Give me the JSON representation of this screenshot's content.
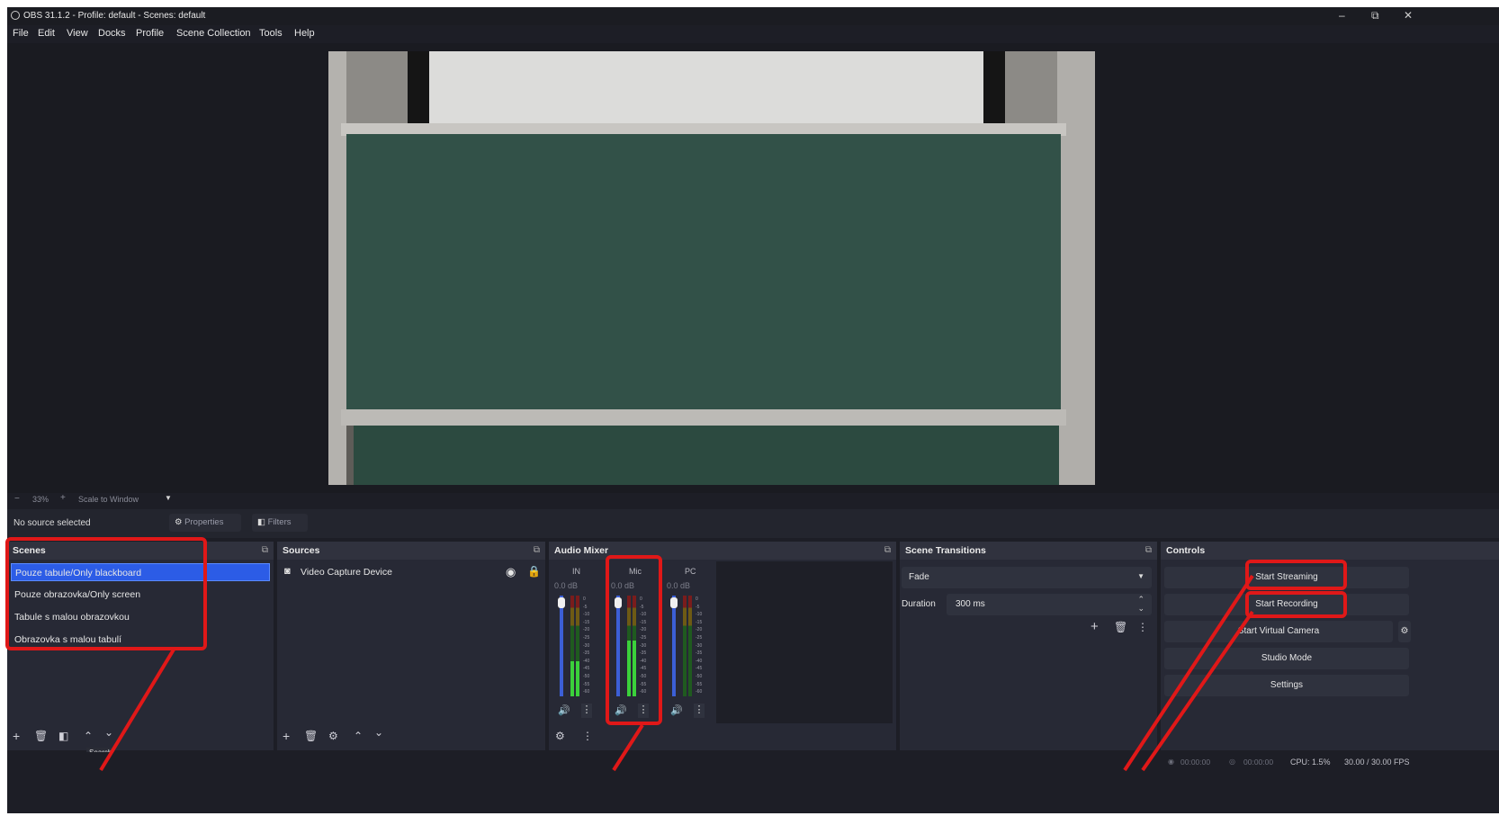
{
  "window": {
    "title": "OBS 31.1.2 - Profile: default - Scenes: default",
    "minimize": "–",
    "restore": "⧉",
    "close": "✕"
  },
  "menu": [
    "File",
    "Edit",
    "View",
    "Docks",
    "Profile",
    "Scene Collection",
    "Tools",
    "Help"
  ],
  "zoom": {
    "minus": "−",
    "value": "33%",
    "plus": "+",
    "mode": "Scale to Window",
    "arrow": "▼"
  },
  "source_bar": {
    "status": "No source selected",
    "properties": "Properties",
    "filters": "Filters"
  },
  "scenes": {
    "title": "Scenes",
    "items": [
      "Pouze tabule/Only blackboard",
      "Pouze obrazovka/Only screen",
      "Tabule s malou obrazovkou",
      "Obrazovka s malou tabulí"
    ],
    "tooltip": "Search"
  },
  "sources": {
    "title": "Sources",
    "items": [
      "Video Capture Device"
    ]
  },
  "audio_mixer": {
    "title": "Audio Mixer",
    "channels": [
      {
        "name": "IN",
        "db": "0.0 dB",
        "level": 0.35
      },
      {
        "name": "Mic",
        "db": "0.0 dB",
        "level": 0.55
      },
      {
        "name": "PC",
        "db": "0.0 dB",
        "level": 0.0
      }
    ],
    "scale": [
      "0",
      "-5",
      "-10",
      "-15",
      "-20",
      "-25",
      "-30",
      "-35",
      "-40",
      "-45",
      "-50",
      "-55",
      "-60"
    ]
  },
  "transitions": {
    "title": "Scene Transitions",
    "selected": "Fade",
    "duration_label": "Duration",
    "duration_value": "300 ms"
  },
  "controls": {
    "title": "Controls",
    "buttons": [
      "Start Streaming",
      "Start Recording",
      "Start Virtual Camera",
      "Studio Mode",
      "Settings"
    ]
  },
  "status": {
    "stream_time": "00:00:00",
    "record_time": "00:00:00",
    "cpu": "CPU: 1.5%",
    "fps": "30.00 / 30.00 FPS"
  },
  "colors": {
    "highlight": "#e01818",
    "selected_scene": "#2c5ce6",
    "meter_green": "#3bd13b",
    "meter_yellow": "#c9a21e",
    "meter_red": "#cc2424"
  }
}
